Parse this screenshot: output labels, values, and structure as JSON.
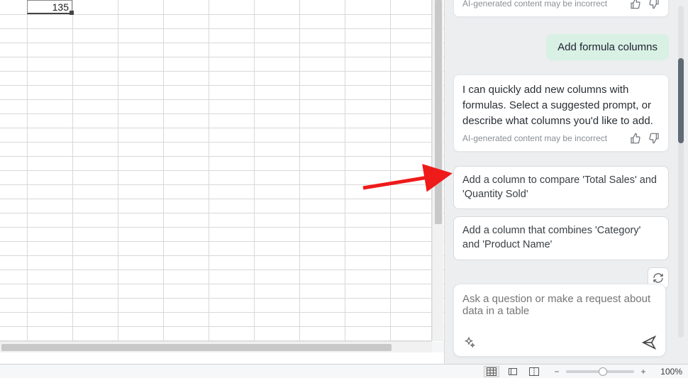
{
  "spreadsheet": {
    "selected_cell_value": "135",
    "above_cell_value": ""
  },
  "copilot": {
    "truncated_disclaimer": "AI-generated content may be incorrect",
    "user_message": "Add formula columns",
    "ai_response": "I can quickly add new columns with formulas. Select a suggested prompt, or describe what columns you'd like to add.",
    "ai_disclaimer": "AI-generated content may be incorrect",
    "suggestions": [
      "Add a column to compare 'Total Sales' and 'Quantity Sold'",
      "Add a column that combines 'Category' and 'Product Name'"
    ],
    "input_placeholder": "Ask a question or make a request about data in a table"
  },
  "statusbar": {
    "zoom_label": "100%"
  },
  "icons": {
    "thumb_up": "thumb-up-icon",
    "thumb_down": "thumb-down-icon",
    "refresh": "refresh-icon",
    "sparkle": "sparkle-icon",
    "send": "send-icon",
    "view_normal": "view-normal-icon",
    "view_page_layout": "view-page-layout-icon",
    "view_page_break": "view-page-break-icon"
  }
}
